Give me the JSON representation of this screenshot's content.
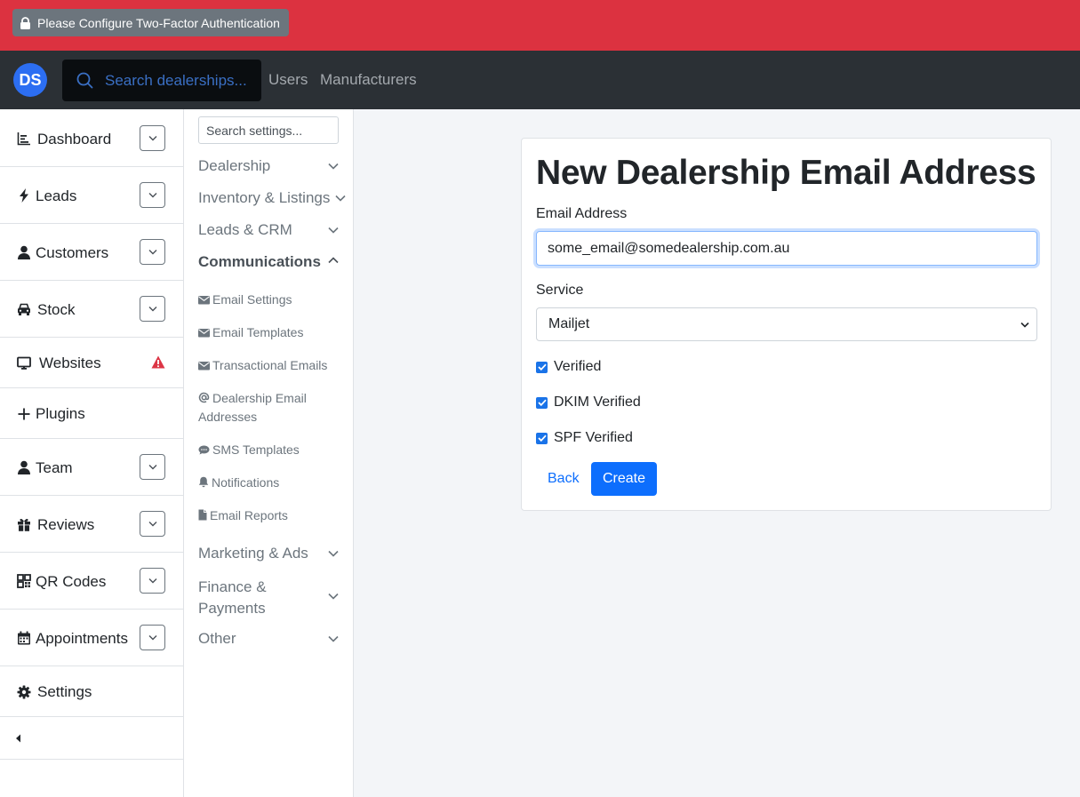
{
  "alert": {
    "text": "Please Configure Two-Factor Authentication"
  },
  "topnav": {
    "logo": "DS",
    "search_placeholder": "Search dealerships...",
    "links": [
      "Users",
      "Manufacturers"
    ]
  },
  "sidebar": {
    "items": [
      {
        "label": "Dashboard",
        "icon": "chart-icon",
        "has_toggle": true
      },
      {
        "label": "Leads",
        "icon": "bolt-icon",
        "has_toggle": true
      },
      {
        "label": "Customers",
        "icon": "user-icon",
        "has_toggle": true
      },
      {
        "label": "Stock",
        "icon": "car-icon",
        "has_toggle": true
      },
      {
        "label": "Websites",
        "icon": "monitor-icon",
        "has_warning": true
      },
      {
        "label": "Plugins",
        "icon": "plus-icon"
      },
      {
        "label": "Team",
        "icon": "user-icon",
        "has_toggle": true
      },
      {
        "label": "Reviews",
        "icon": "gift-icon",
        "has_toggle": true
      },
      {
        "label": "QR Codes",
        "icon": "qrcode-icon",
        "has_toggle": true
      },
      {
        "label": "Appointments",
        "icon": "calendar-icon",
        "has_toggle": true
      },
      {
        "label": "Settings",
        "icon": "gear-icon"
      }
    ]
  },
  "settings_nav": {
    "search_placeholder": "Search settings...",
    "categories": {
      "dealership": "Dealership",
      "inventory": "Inventory & Listings",
      "leads_crm": "Leads & CRM",
      "communications": "Communications",
      "marketing": "Marketing & Ads",
      "finance": "Finance & Payments",
      "other": "Other"
    },
    "communications_items": {
      "email_settings": "Email Settings",
      "email_templates": "Email Templates",
      "transactional_emails": "Transactional Emails",
      "dealership_email_addresses": "Dealership Email Addresses",
      "sms_templates": "SMS Templates",
      "notifications": "Notifications",
      "email_reports": "Email Reports"
    }
  },
  "form": {
    "title": "New Dealership Email Address",
    "email_label": "Email Address",
    "email_value": "some_email@somedealership.com.au",
    "service_label": "Service",
    "service_value": "Mailjet",
    "checkboxes": {
      "verified": "Verified",
      "dkim": "DKIM Verified",
      "spf": "SPF Verified"
    },
    "checked": {
      "verified": true,
      "dkim": true,
      "spf": true
    },
    "back_label": "Back",
    "create_label": "Create"
  },
  "colors": {
    "alert_bar": "#dc3240",
    "navbar": "#2b3035",
    "accent": "#0d6efd",
    "warning": "#dc3545"
  }
}
